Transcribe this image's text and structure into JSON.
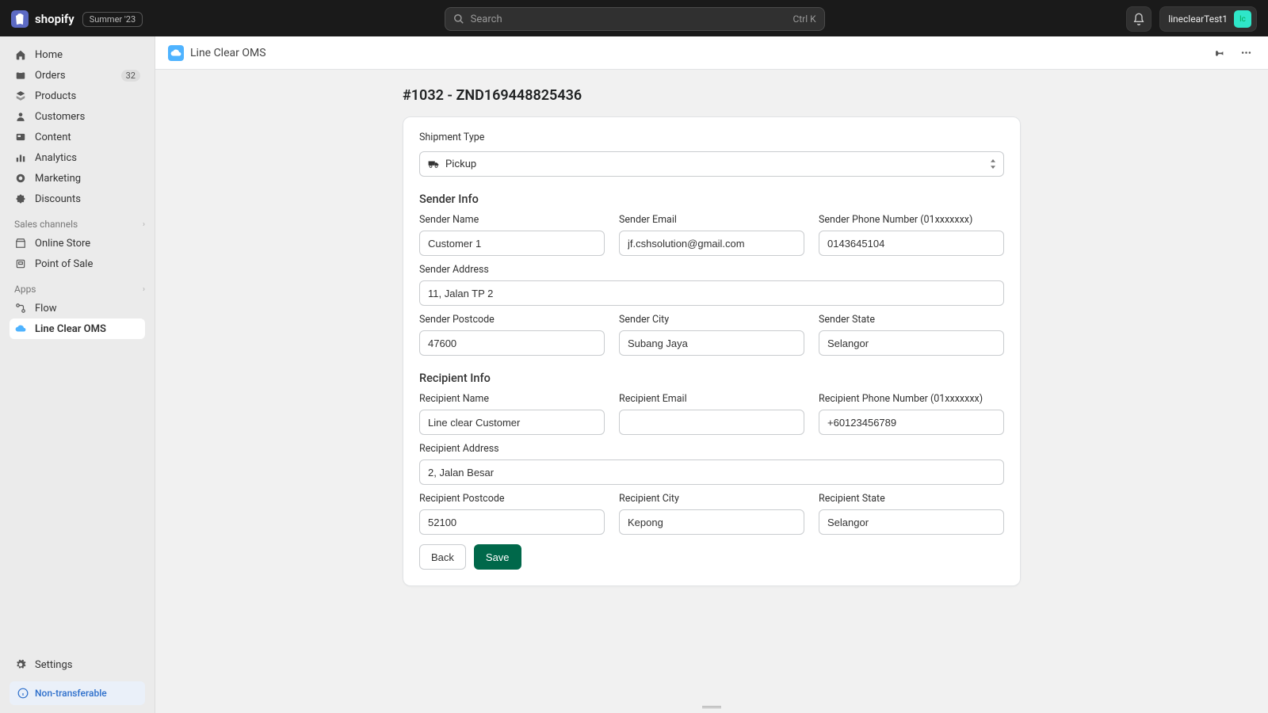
{
  "topbar": {
    "brand": "shopify",
    "badge": "Summer '23",
    "search_placeholder": "Search",
    "search_shortcut": "Ctrl K",
    "username": "lineclearTest1"
  },
  "sidebar": {
    "items": [
      {
        "label": "Home"
      },
      {
        "label": "Orders",
        "badge": "32"
      },
      {
        "label": "Products"
      },
      {
        "label": "Customers"
      },
      {
        "label": "Content"
      },
      {
        "label": "Analytics"
      },
      {
        "label": "Marketing"
      },
      {
        "label": "Discounts"
      }
    ],
    "sales_channels_label": "Sales channels",
    "sales_channels": [
      {
        "label": "Online Store"
      },
      {
        "label": "Point of Sale"
      }
    ],
    "apps_label": "Apps",
    "apps": [
      {
        "label": "Flow"
      },
      {
        "label": "Line Clear OMS"
      }
    ],
    "settings_label": "Settings",
    "nontransferable_label": "Non-transferable"
  },
  "appHeader": {
    "title": "Line Clear OMS"
  },
  "page": {
    "title": "#1032 - ZND169448825436",
    "shipment_type_label": "Shipment Type",
    "shipment_type_value": "Pickup",
    "sender_info_title": "Sender Info",
    "sender": {
      "name_label": "Sender Name",
      "name_value": "Customer 1",
      "email_label": "Sender Email",
      "email_value": "jf.cshsolution@gmail.com",
      "phone_label": "Sender Phone Number (01xxxxxxx)",
      "phone_value": "0143645104",
      "address_label": "Sender Address",
      "address_value": "11, Jalan TP 2",
      "postcode_label": "Sender Postcode",
      "postcode_value": "47600",
      "city_label": "Sender City",
      "city_value": "Subang Jaya",
      "state_label": "Sender State",
      "state_value": "Selangor"
    },
    "recipient_info_title": "Recipient Info",
    "recipient": {
      "name_label": "Recipient Name",
      "name_value": "Line clear Customer",
      "email_label": "Recipient Email",
      "email_value": "",
      "phone_label": "Recipient Phone Number (01xxxxxxx)",
      "phone_value": "+60123456789",
      "address_label": "Recipient Address",
      "address_value": "2, Jalan Besar",
      "postcode_label": "Recipient Postcode",
      "postcode_value": "52100",
      "city_label": "Recipient City",
      "city_value": "Kepong",
      "state_label": "Recipient State",
      "state_value": "Selangor"
    },
    "back_label": "Back",
    "save_label": "Save"
  }
}
